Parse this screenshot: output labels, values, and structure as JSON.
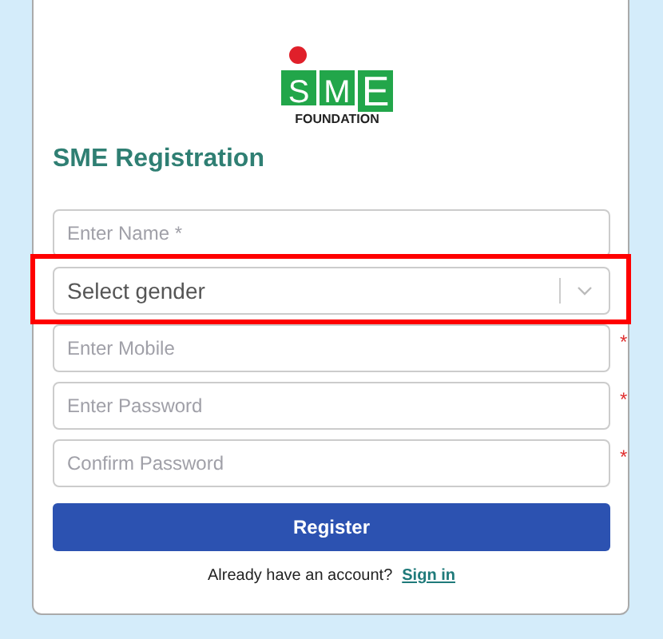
{
  "logo": {
    "letters": [
      "S",
      "M",
      "E"
    ],
    "subtitle": "FOUNDATION"
  },
  "title": "SME Registration",
  "fields": [
    {
      "kind": "input",
      "placeholder": "Enter Name *",
      "highlighted": false
    },
    {
      "kind": "select",
      "placeholder": "Select gender",
      "highlighted": true
    },
    {
      "kind": "input",
      "placeholder": "Enter Mobile",
      "required_mark": "*",
      "highlighted": false
    },
    {
      "kind": "input",
      "placeholder": "Enter Password",
      "required_mark": "*",
      "highlighted": false
    },
    {
      "kind": "input",
      "placeholder": "Confirm Password",
      "required_mark": "*",
      "highlighted": false
    }
  ],
  "submit": "Register",
  "footer": {
    "text": "Already have an account?",
    "link": "Sign in"
  }
}
